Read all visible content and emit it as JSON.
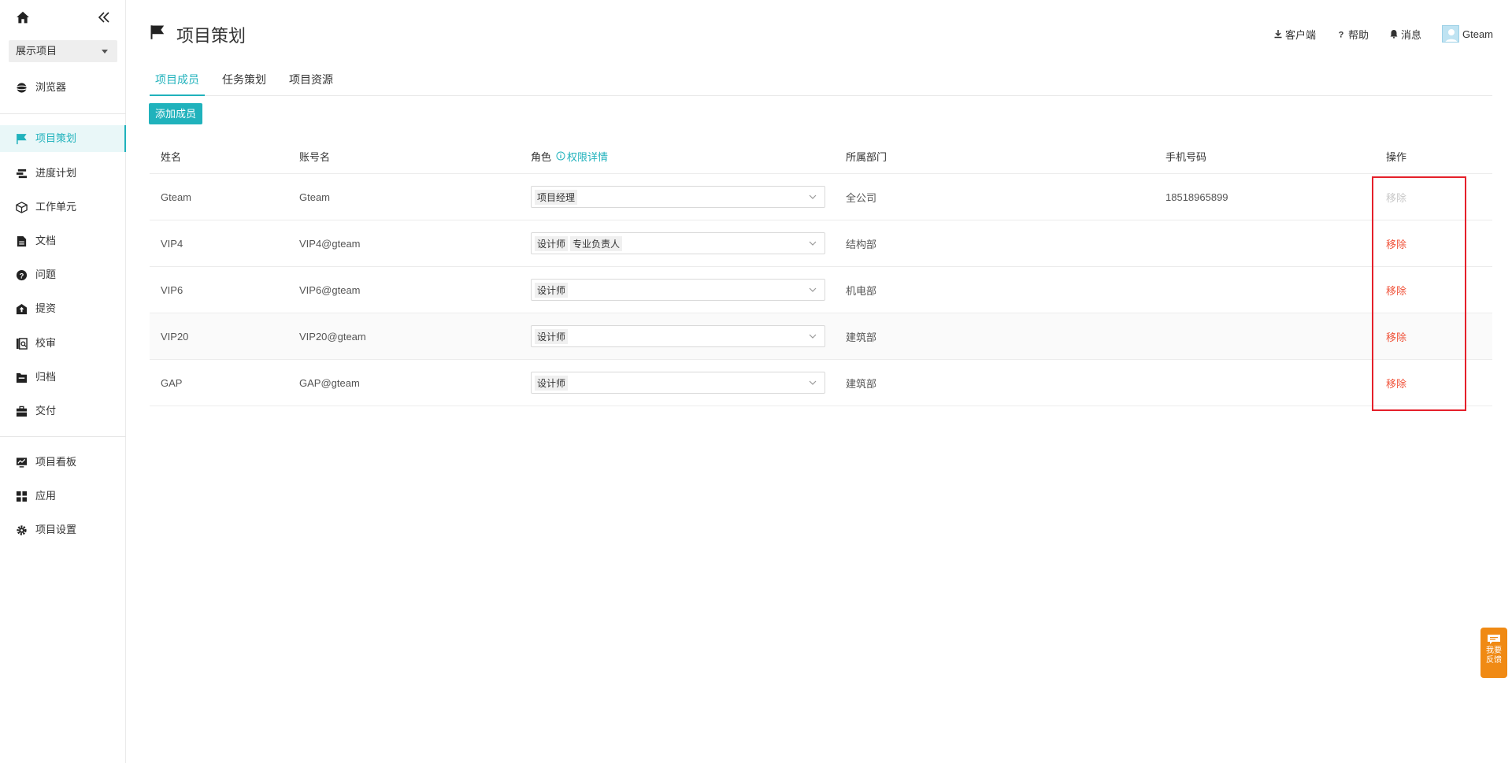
{
  "sidebar": {
    "project_select": "展示项目",
    "items": [
      {
        "label": "浏览器"
      },
      {
        "label": "项目策划"
      },
      {
        "label": "进度计划"
      },
      {
        "label": "工作单元"
      },
      {
        "label": "文档"
      },
      {
        "label": "问题"
      },
      {
        "label": "提资"
      },
      {
        "label": "校审"
      },
      {
        "label": "归档"
      },
      {
        "label": "交付"
      },
      {
        "label": "项目看板"
      },
      {
        "label": "应用"
      },
      {
        "label": "项目设置"
      }
    ]
  },
  "header": {
    "title": "项目策划",
    "client": "客户端",
    "help": "帮助",
    "messages": "消息",
    "user": "Gteam"
  },
  "tabs": [
    {
      "label": "项目成员"
    },
    {
      "label": "任务策划"
    },
    {
      "label": "项目资源"
    }
  ],
  "add_member_label": "添加成员",
  "table": {
    "headers": {
      "name": "姓名",
      "account": "账号名",
      "role": "角色",
      "perm_detail": "权限详情",
      "dept": "所属部门",
      "phone": "手机号码",
      "op": "操作"
    },
    "rows": [
      {
        "name": "Gteam",
        "account": "Gteam",
        "roles": [
          "项目经理"
        ],
        "dept": "全公司",
        "phone": "18518965899",
        "op": "移除",
        "op_disabled": true
      },
      {
        "name": "VIP4",
        "account": "VIP4@gteam",
        "roles": [
          "设计师",
          "专业负责人"
        ],
        "dept": "结构部",
        "phone": "",
        "op": "移除",
        "op_disabled": false
      },
      {
        "name": "VIP6",
        "account": "VIP6@gteam",
        "roles": [
          "设计师"
        ],
        "dept": "机电部",
        "phone": "",
        "op": "移除",
        "op_disabled": false
      },
      {
        "name": "VIP20",
        "account": "VIP20@gteam",
        "roles": [
          "设计师"
        ],
        "dept": "建筑部",
        "phone": "",
        "op": "移除",
        "op_disabled": false
      },
      {
        "name": "GAP",
        "account": "GAP@gteam",
        "roles": [
          "设计师"
        ],
        "dept": "建筑部",
        "phone": "",
        "op": "移除",
        "op_disabled": false
      }
    ]
  },
  "feedback": {
    "line1": "我要",
    "line2": "反馈"
  },
  "colors": {
    "accent": "#20b2bc",
    "remove": "#f0533a",
    "highlight": "#e5202a",
    "feedback": "#f08a14"
  }
}
